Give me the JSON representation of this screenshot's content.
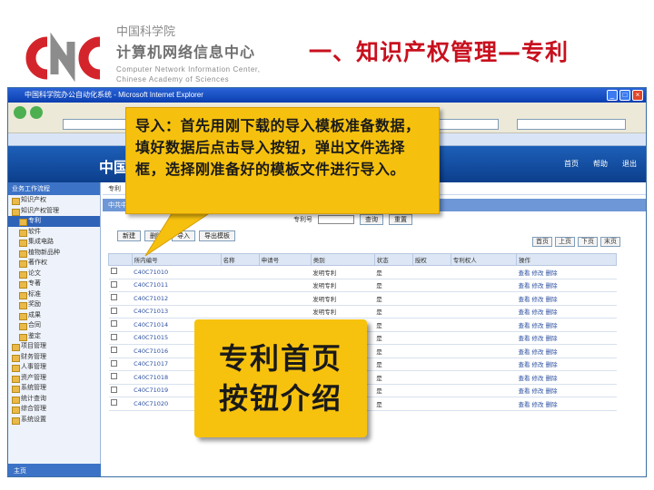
{
  "header": {
    "org_cn": "中国科学院",
    "org_center": "计算机网络信息中心",
    "org_en_line1": "Computer Network Information Center,",
    "org_en_line2": "Chinese Academy of Sciences",
    "slide_title": "一、知识产权管理—专利",
    "logo_icon": "cnic-logo-icon",
    "colors": {
      "title_red": "#c8101e",
      "logo_red": "#d4242b",
      "logo_gray": "#8c8c8c"
    }
  },
  "browser": {
    "window_title": "中国科学院办公自动化系统 - Microsoft Internet Explorer",
    "app_header_title": "中国",
    "top_links": [
      "首页",
      "帮助",
      "退出"
    ],
    "breadcrumb": "专利",
    "panel_title": "中共中央",
    "search_label": "专利号",
    "left_nav": {
      "header": "业务工作流程",
      "items": [
        {
          "label": "知识产权",
          "level": 0,
          "selected": false
        },
        {
          "label": "知识产权管理",
          "level": 0,
          "selected": false
        },
        {
          "label": "专利",
          "level": 1,
          "selected": true
        },
        {
          "label": "软件",
          "level": 1,
          "selected": false
        },
        {
          "label": "集成电路",
          "level": 1,
          "selected": false
        },
        {
          "label": "植物新品种",
          "level": 1,
          "selected": false
        },
        {
          "label": "著作权",
          "level": 1,
          "selected": false
        },
        {
          "label": "论文",
          "level": 1,
          "selected": false
        },
        {
          "label": "专著",
          "level": 1,
          "selected": false
        },
        {
          "label": "标准",
          "level": 1,
          "selected": false
        },
        {
          "label": "奖励",
          "level": 1,
          "selected": false
        },
        {
          "label": "成果",
          "level": 1,
          "selected": false
        },
        {
          "label": "合同",
          "level": 1,
          "selected": false
        },
        {
          "label": "鉴定",
          "level": 1,
          "selected": false
        },
        {
          "label": "项目管理",
          "level": 0,
          "selected": false
        },
        {
          "label": "财务管理",
          "level": 0,
          "selected": false
        },
        {
          "label": "人事管理",
          "level": 0,
          "selected": false
        },
        {
          "label": "资产管理",
          "level": 0,
          "selected": false
        },
        {
          "label": "系统管理",
          "level": 0,
          "selected": false
        },
        {
          "label": "统计查询",
          "level": 0,
          "selected": false
        },
        {
          "label": "综合管理",
          "level": 0,
          "selected": false
        },
        {
          "label": "系统设置",
          "level": 0,
          "selected": false
        }
      ],
      "footer": "主页"
    },
    "buttons": [
      "新建",
      "删除",
      "导入",
      "导出模板"
    ],
    "search_buttons": [
      "查询",
      "重置"
    ],
    "pager": {
      "labels": [
        "首页",
        "上页",
        "下页",
        "末页"
      ]
    },
    "table": {
      "columns": [
        "",
        "所内编号",
        "名称",
        "申请号",
        "类别",
        "状态",
        "授权",
        "专利权人",
        "操作"
      ],
      "rows": [
        [
          "",
          "C40C71010",
          "",
          "",
          "发明专利",
          "是",
          "",
          "",
          "查看 修改 删除"
        ],
        [
          "",
          "C40C71011",
          "",
          "",
          "发明专利",
          "是",
          "",
          "",
          "查看 修改 删除"
        ],
        [
          "",
          "C40C71012",
          "",
          "",
          "发明专利",
          "是",
          "",
          "",
          "查看 修改 删除"
        ],
        [
          "",
          "C40C71013",
          "",
          "",
          "发明专利",
          "是",
          "",
          "",
          "查看 修改 删除"
        ],
        [
          "",
          "C40C71014",
          "",
          "",
          "发明专利",
          "是",
          "",
          "",
          "查看 修改 删除"
        ],
        [
          "",
          "C40C71015",
          "",
          "",
          "发明专利",
          "是",
          "",
          "",
          "查看 修改 删除"
        ],
        [
          "",
          "C40C71016",
          "",
          "",
          "发明专利",
          "是",
          "",
          "",
          "查看 修改 删除"
        ],
        [
          "",
          "C40C71017",
          "",
          "",
          "发明专利",
          "是",
          "",
          "",
          "查看 修改 删除"
        ],
        [
          "",
          "C40C71018",
          "",
          "",
          "发明专利",
          "是",
          "",
          "",
          "查看 修改 删除"
        ],
        [
          "",
          "C40C71019",
          "",
          "",
          "发明专利",
          "是",
          "",
          "",
          "查看 修改 删除"
        ],
        [
          "",
          "C40C71020",
          "",
          "",
          "发明专利",
          "是",
          "",
          "",
          "查看 修改 删除"
        ]
      ]
    }
  },
  "callouts": {
    "import_note": "导入：首先用刚下载的导入模板准备数据，填好数据后点击导入按钮，弹出文件选择框，选择刚准备好的模板文件进行导入。",
    "home_buttons_line1": "专利首页",
    "home_buttons_line2": "按钮介绍",
    "colors": {
      "callout_yellow": "#f6c10e"
    }
  }
}
